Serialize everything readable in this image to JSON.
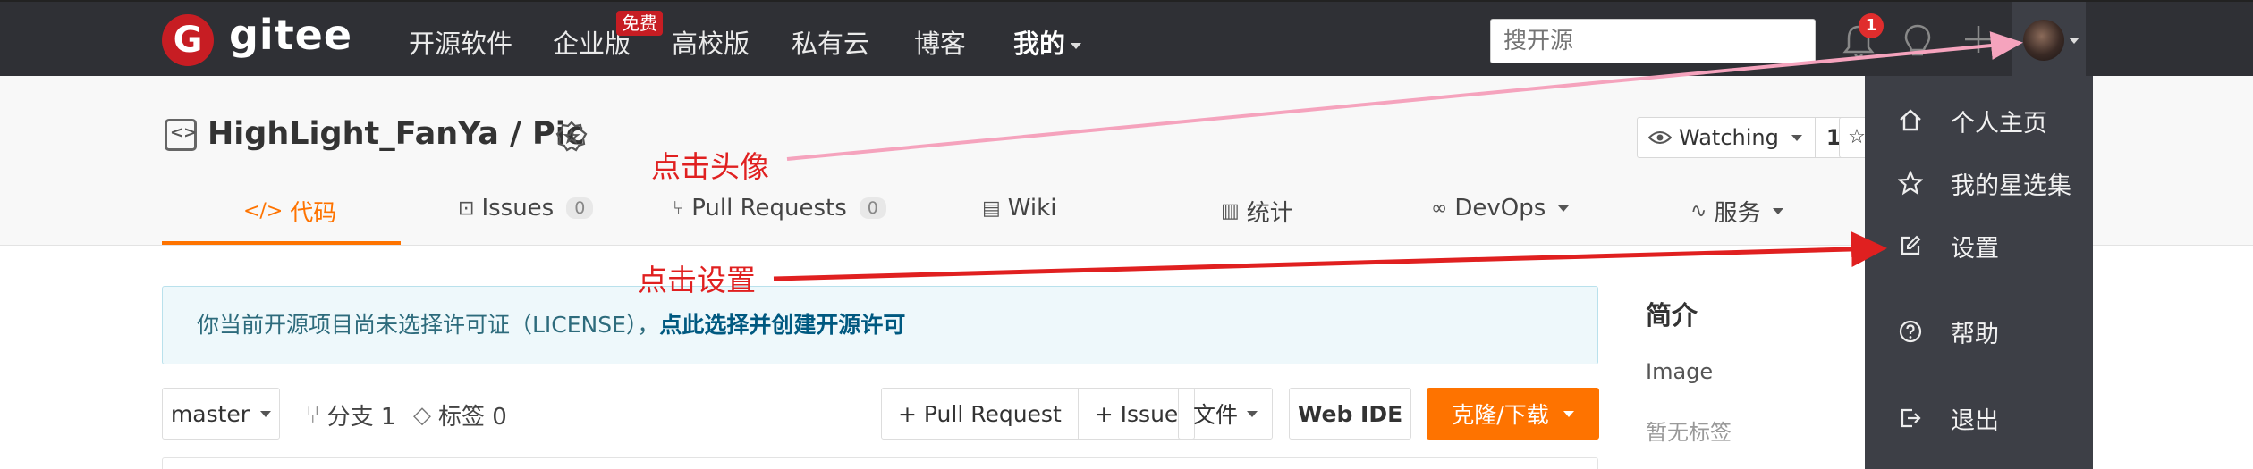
{
  "topnav": {
    "logo_letter": "G",
    "logo_text": "gitee",
    "items": [
      {
        "label": "开源软件"
      },
      {
        "label": "企业版"
      },
      {
        "label": "高校版"
      },
      {
        "label": "私有云"
      },
      {
        "label": "博客"
      },
      {
        "label": "我的"
      }
    ],
    "enterprise_badge": "免费",
    "search_placeholder": "搜开源",
    "notification_count": "1",
    "icons": [
      "bell-icon",
      "lightbulb-icon",
      "plus-icon",
      "avatar"
    ]
  },
  "project": {
    "title": "HighLight_FanYa / Pic",
    "watch_label": "Watching",
    "watch_count": "1",
    "tabs": [
      {
        "label": "代码",
        "icon": "code-icon",
        "active": true
      },
      {
        "label": "Issues",
        "icon": "issue-icon",
        "count": "0"
      },
      {
        "label": "Pull Requests",
        "icon": "pull-request-icon",
        "count": "0"
      },
      {
        "label": "Wiki",
        "icon": "book-icon"
      },
      {
        "label": "统计",
        "icon": "bar-chart-icon"
      },
      {
        "label": "DevOps",
        "icon": "infinity-icon"
      },
      {
        "label": "服务",
        "icon": "pulse-icon"
      }
    ]
  },
  "main": {
    "license_text": "你当前开源项目尚未选择许可证（LICENSE），",
    "license_link": "点此选择并创建开源许可",
    "branch": "master",
    "branches_label": "分支 1",
    "tags_label": "标签 0",
    "buttons": {
      "pull_request": "+ Pull Request",
      "issue": "+ Issue",
      "file": "文件",
      "web_ide": "Web IDE",
      "clone": "克隆/下载"
    }
  },
  "sidebar": {
    "intro_title": "简介",
    "intro_desc": "Image",
    "no_tags": "暂无标签"
  },
  "user_menu": {
    "items": [
      {
        "label": "个人主页",
        "icon": "home-icon"
      },
      {
        "label": "我的星选集",
        "icon": "star-icon"
      },
      {
        "label": "设置",
        "icon": "edit-icon"
      },
      {
        "label": "帮助",
        "icon": "help-icon"
      },
      {
        "label": "退出",
        "icon": "logout-icon"
      }
    ]
  },
  "annotations": {
    "click_avatar": "点击头像",
    "click_settings": "点击设置"
  },
  "colors": {
    "nav_bg": "#2f3035",
    "accent": "#fe7300",
    "brand_red": "#c71d23",
    "menu_bg": "#3d3f46",
    "annotation_red": "#e02020",
    "annotation_pink": "#f5a3bd"
  }
}
